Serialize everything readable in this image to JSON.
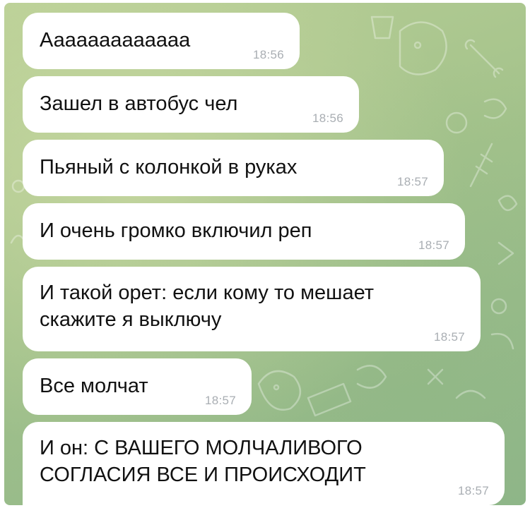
{
  "chat": {
    "messages": [
      {
        "lines": [
          "Ааааааааааааа"
        ],
        "time": "18:56"
      },
      {
        "lines": [
          "Зашел в автобус чел"
        ],
        "time": "18:56"
      },
      {
        "lines": [
          "Пьяный с колонкой в руках"
        ],
        "time": "18:57"
      },
      {
        "lines": [
          "И очень громко включил реп"
        ],
        "time": "18:57"
      },
      {
        "lines": [
          "И такой орет: если кому то мешает",
          "скажите я выключу"
        ],
        "time": "18:57"
      },
      {
        "lines": [
          "Все молчат"
        ],
        "time": "18:57"
      },
      {
        "lines": [
          "И он: С ВАШЕГО МОЛЧАЛИВОГО",
          "СОГЛАСИЯ ВСЕ И ПРОИСХОДИТ"
        ],
        "time": "18:57"
      }
    ]
  },
  "colors": {
    "bubble": "#ffffff",
    "text": "#111111",
    "timestamp": "#a9aeb3",
    "wallpaper_start": "#b9cf96",
    "wallpaper_end": "#8fb68a"
  }
}
